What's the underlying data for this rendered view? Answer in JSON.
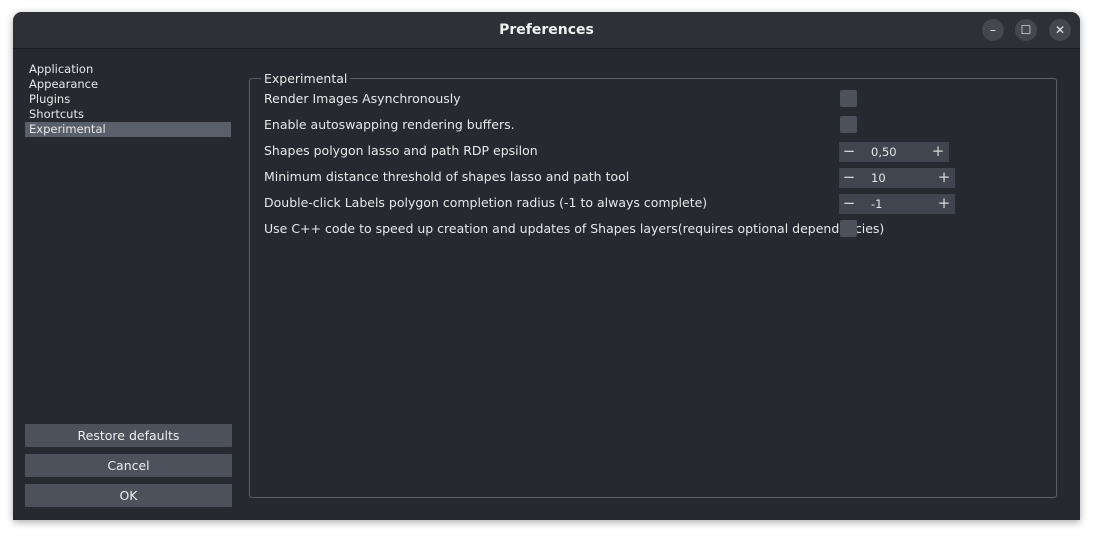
{
  "window": {
    "title": "Preferences",
    "controls": {
      "minimize": "–",
      "maximize": "☐",
      "close": "✕"
    }
  },
  "sidebar": {
    "items": [
      {
        "label": "Application"
      },
      {
        "label": "Appearance"
      },
      {
        "label": "Plugins"
      },
      {
        "label": "Shortcuts"
      },
      {
        "label": "Experimental",
        "selected": true
      }
    ]
  },
  "buttons": {
    "restore_defaults": "Restore defaults",
    "cancel": "Cancel",
    "ok": "OK"
  },
  "experimental": {
    "group_title": "Experimental",
    "settings": [
      {
        "label": "Render Images Asynchronously",
        "type": "checkbox",
        "checked": false
      },
      {
        "label": "Enable autoswapping rendering buffers.",
        "type": "checkbox",
        "checked": false
      },
      {
        "label": "Shapes polygon lasso and path RDP epsilon",
        "type": "spinbox",
        "value": "0,50",
        "minus": "−",
        "plus": "+"
      },
      {
        "label": "Minimum distance threshold of shapes lasso and path tool",
        "type": "spinbox",
        "value": "10",
        "minus": "−",
        "plus": "+"
      },
      {
        "label": "Double-click Labels polygon completion radius (-1 to always complete)",
        "type": "spinbox",
        "value": "-1",
        "minus": "−",
        "plus": "+"
      },
      {
        "label": "Use C++ code to speed up creation and updates of Shapes layers(requires optional dependencies)",
        "type": "checkbox",
        "checked": false
      }
    ]
  },
  "colors": {
    "window_bg": "#262930",
    "titlebar_bg": "#2e3036",
    "selected_item": "#5a5f6c",
    "button_bg": "#4c515c",
    "spinbox_bg": "#404550"
  }
}
